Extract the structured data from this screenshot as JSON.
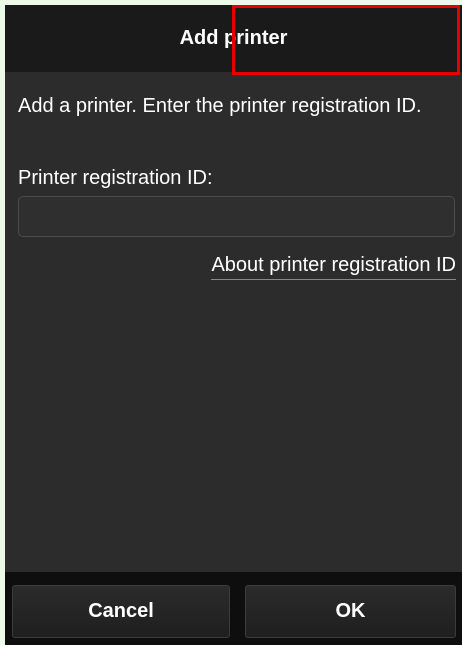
{
  "dialog": {
    "title": "Add printer",
    "intro_text": "Add a printer. Enter the printer registration ID.",
    "field_label": "Printer registration ID:",
    "field_value": "",
    "field_placeholder": "",
    "about_link": "About printer registration ID"
  },
  "buttons": {
    "cancel_label": "Cancel",
    "ok_label": "OK"
  },
  "colors": {
    "page_background": "#ecfbe6",
    "screen_background": "#2c2c2c",
    "title_bar": "#1a1a1a",
    "bottom_bar": "#0e0e0e",
    "highlight": "#e60000",
    "text": "#ffffff"
  }
}
